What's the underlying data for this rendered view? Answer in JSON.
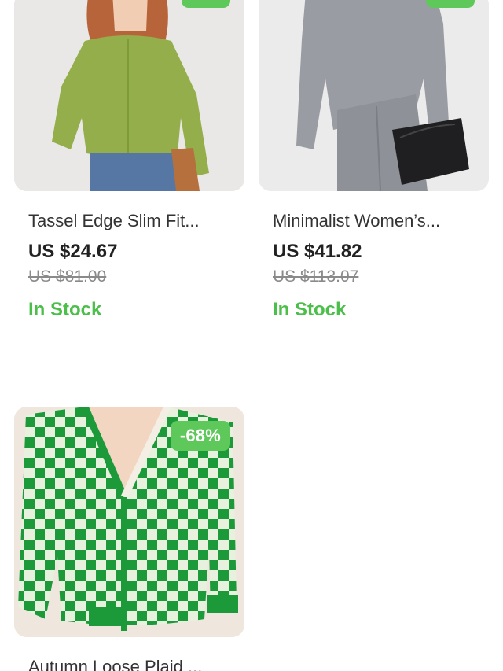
{
  "products": [
    {
      "title": "Tassel Edge Slim Fit...",
      "price": "US $24.67",
      "original_price": "US $81.00",
      "stock": "In Stock",
      "image_icon": "green-cardigan-photo"
    },
    {
      "title": "Minimalist Women’s...",
      "price": "US $41.82",
      "original_price": "US $113.07",
      "stock": "In Stock",
      "image_icon": "grey-sweater-photo"
    },
    {
      "title": "Autumn Loose Plaid ...",
      "discount": "-68%",
      "image_icon": "checkered-cardigan-photo"
    }
  ],
  "colors": {
    "badge": "#5ec85a",
    "stock": "#4cbf4a",
    "price": "#222222",
    "original_price": "#8a8a8a"
  }
}
